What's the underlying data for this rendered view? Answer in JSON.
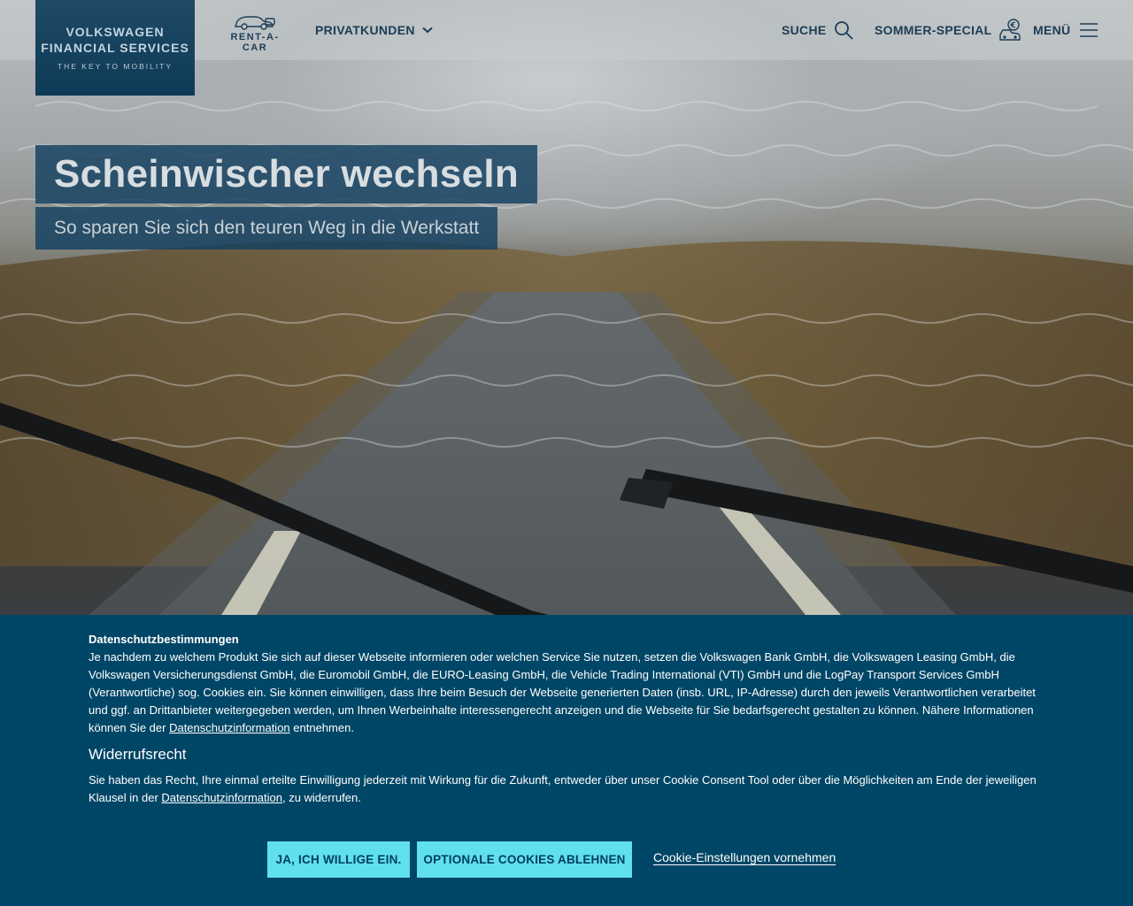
{
  "header": {
    "logo": {
      "line1": "VOLKSWAGEN",
      "line2": "FINANCIAL SERVICES",
      "tagline": "THE KEY TO MOBILITY"
    },
    "rent_a_car": "RENT-A-CAR",
    "privatkunden": "PRIVATKUNDEN",
    "suche": "SUCHE",
    "sommer_special": "SOMMER-SPECIAL",
    "menu": "MENÜ"
  },
  "hero": {
    "title": "Scheinwischer wechseln",
    "subtitle": "So sparen Sie sich den teuren Weg in die Werkstatt"
  },
  "cookie_banner": {
    "heading": "Datenschutzbestimmungen",
    "paragraph1": "Je nachdem zu welchem Produkt Sie sich auf dieser Webseite informieren oder welchen Service Sie nutzen, setzen die Volkswagen Bank GmbH, die Volkswagen Leasing GmbH, die Volkswagen Versicherungsdienst GmbH, die Euromobil GmbH, die EURO-Leasing GmbH, die Vehicle Trading International (VTI) GmbH und die LogPay Transport Services GmbH (Verantwortliche) sog. Cookies ein. Sie können einwilligen, dass Ihre beim Besuch der Webseite generierten Daten (insb. URL, IP-Adresse) durch den jeweils Verantwortlichen verarbeitet und ggf. an Drittanbieter weitergegeben werden, um Ihnen Werbeinhalte interessengerecht anzeigen und die Webseite für Sie bedarfsgerecht gestalten zu können. Nähere Informationen können Sie der ",
    "paragraph1_link": "Datenschutzinformation",
    "paragraph1_end": " entnehmen.",
    "revocation_heading": "Widerrufsrecht",
    "paragraph2": "Sie haben das Recht, Ihre einmal erteilte Einwilligung jederzeit mit Wirkung für die Zukunft, entweder über unser Cookie Consent Tool oder über die Möglichkeiten am Ende der jeweiligen Klausel in der ",
    "paragraph2_link": "Datenschutzinformation",
    "paragraph2_end": ", zu widerrufen.",
    "accept_button": "JA, ICH WILLIGE EIN.",
    "reject_button": "OPTIONALE COOKIES ABLEHNEN",
    "settings_link": "Cookie-Einstellungen vornehmen"
  },
  "colors": {
    "brand_dark": "#004666",
    "button_accent": "#5fe0ec",
    "nav_text": "#1c3d55"
  }
}
